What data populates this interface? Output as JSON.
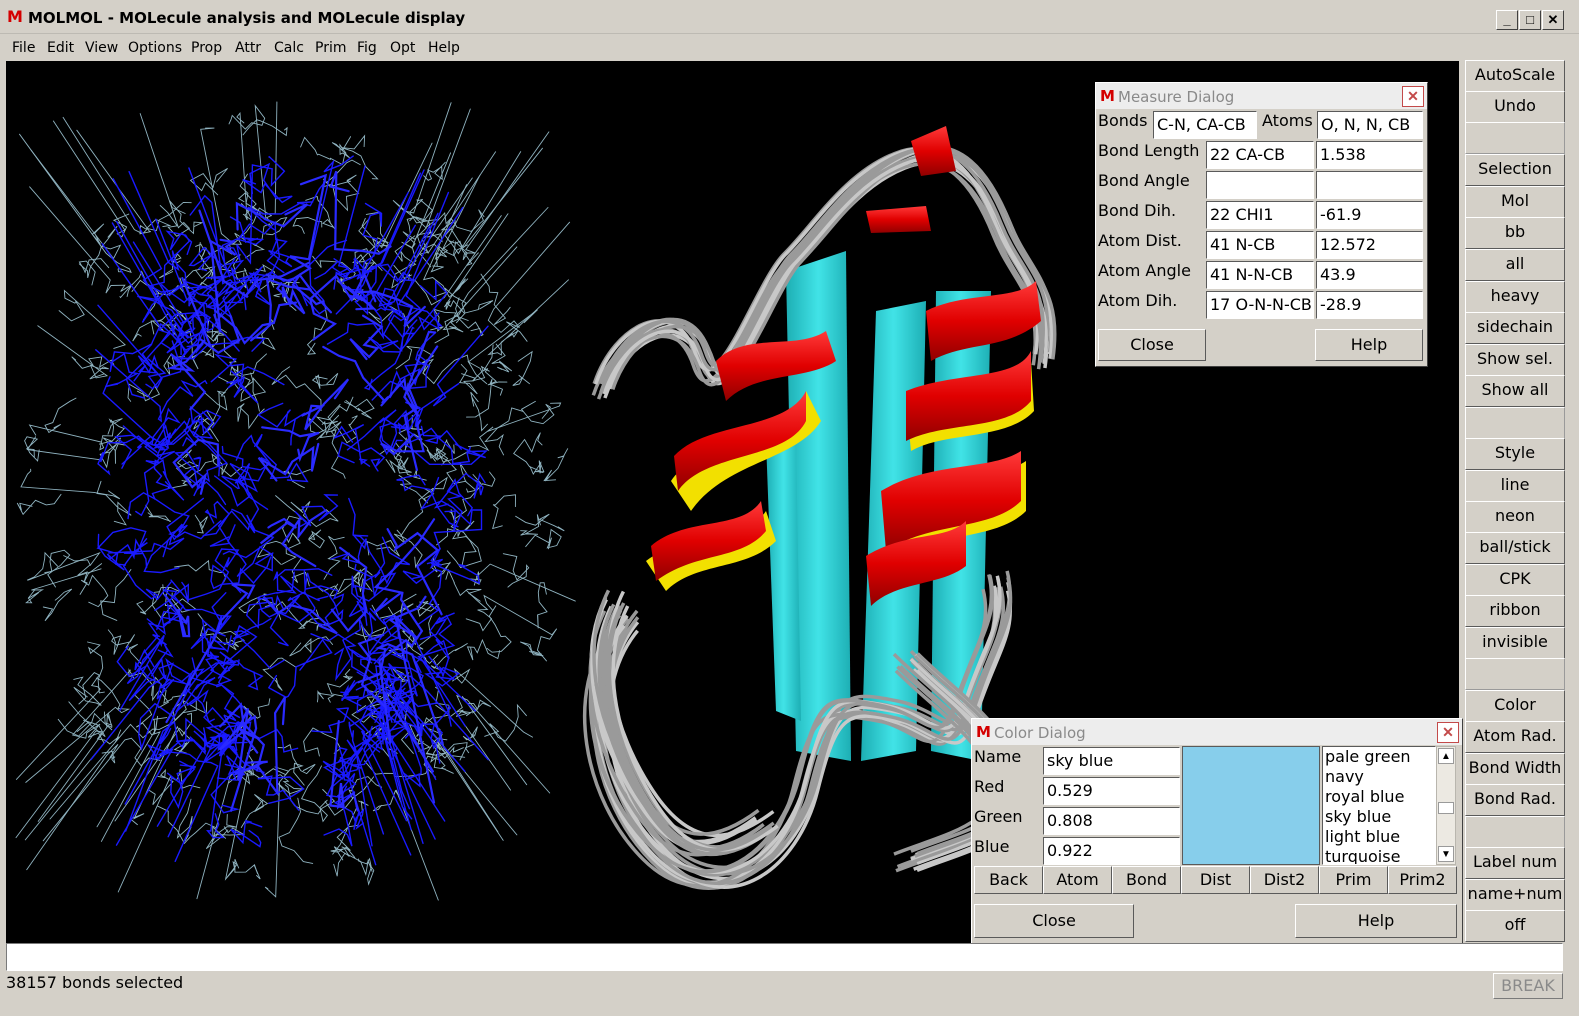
{
  "window": {
    "title": "MOLMOL - MOLecule analysis and MOLecule display",
    "logo": "M",
    "controls": [
      "minimize-icon",
      "maximize-icon",
      "close-icon"
    ]
  },
  "menu": [
    "File",
    "Edit",
    "View",
    "Options",
    "Prop",
    "Attr",
    "Calc",
    "Prim",
    "Fig",
    "Opt",
    "Help"
  ],
  "side_buttons": {
    "autoscale": "AutoScale",
    "undo": "Undo",
    "selection": "Selection",
    "mol": "Mol",
    "bb": "bb",
    "all": "all",
    "heavy": "heavy",
    "sidechain": "sidechain",
    "show_sel": "Show sel.",
    "show_all": "Show all",
    "style": "Style",
    "line": "line",
    "neon": "neon",
    "ball_stick": "ball/stick",
    "cpk": "CPK",
    "ribbon": "ribbon",
    "invisible": "invisible",
    "color": "Color",
    "atom_rad": "Atom Rad.",
    "bond_width": "Bond Width",
    "bond_rad": "Bond Rad.",
    "label_num": "Label num",
    "name_num": "name+num",
    "off": "off"
  },
  "measure_dialog": {
    "title": "Measure Dialog",
    "bonds_label": "Bonds",
    "bonds_value": "C-N, CA-CB",
    "atoms_label": "Atoms",
    "atoms_value": "O, N, N, CB",
    "rows": [
      {
        "label": "Bond Length",
        "name": "22 CA-CB",
        "value": "1.538"
      },
      {
        "label": "Bond Angle",
        "name": "",
        "value": ""
      },
      {
        "label": "Bond Dih.",
        "name": "22 CHI1",
        "value": "-61.9"
      },
      {
        "label": "Atom Dist.",
        "name": "41 N-CB",
        "value": "12.572"
      },
      {
        "label": "Atom Angle",
        "name": "41 N-N-CB",
        "value": "43.9"
      },
      {
        "label": "Atom Dih.",
        "name": "17 O-N-N-CB",
        "value": "-28.9"
      }
    ],
    "close": "Close",
    "help": "Help"
  },
  "color_dialog": {
    "title": "Color Dialog",
    "name_label": "Name",
    "name_value": "sky blue",
    "red_label": "Red",
    "red_value": "0.529",
    "green_label": "Green",
    "green_value": "0.808",
    "blue_label": "Blue",
    "blue_value": "0.922",
    "swatch_color": "#87CEEB",
    "color_list": [
      "pale green",
      "navy",
      "royal blue",
      "sky blue",
      "light blue",
      "turquoise"
    ],
    "targets": [
      "Back",
      "Atom",
      "Bond",
      "Dist",
      "Dist2",
      "Prim",
      "Prim2"
    ],
    "close": "Close",
    "help": "Help"
  },
  "status": {
    "message": "38157 bonds selected",
    "break": "BREAK"
  },
  "colors": {
    "wire_backbone": "#1a1aff",
    "wire_sidechain": "#8fb3c0",
    "helix": "#e60000",
    "helix_inner": "#f2e000",
    "sheet": "#33e0e6",
    "coil": "#9a9a9a"
  }
}
